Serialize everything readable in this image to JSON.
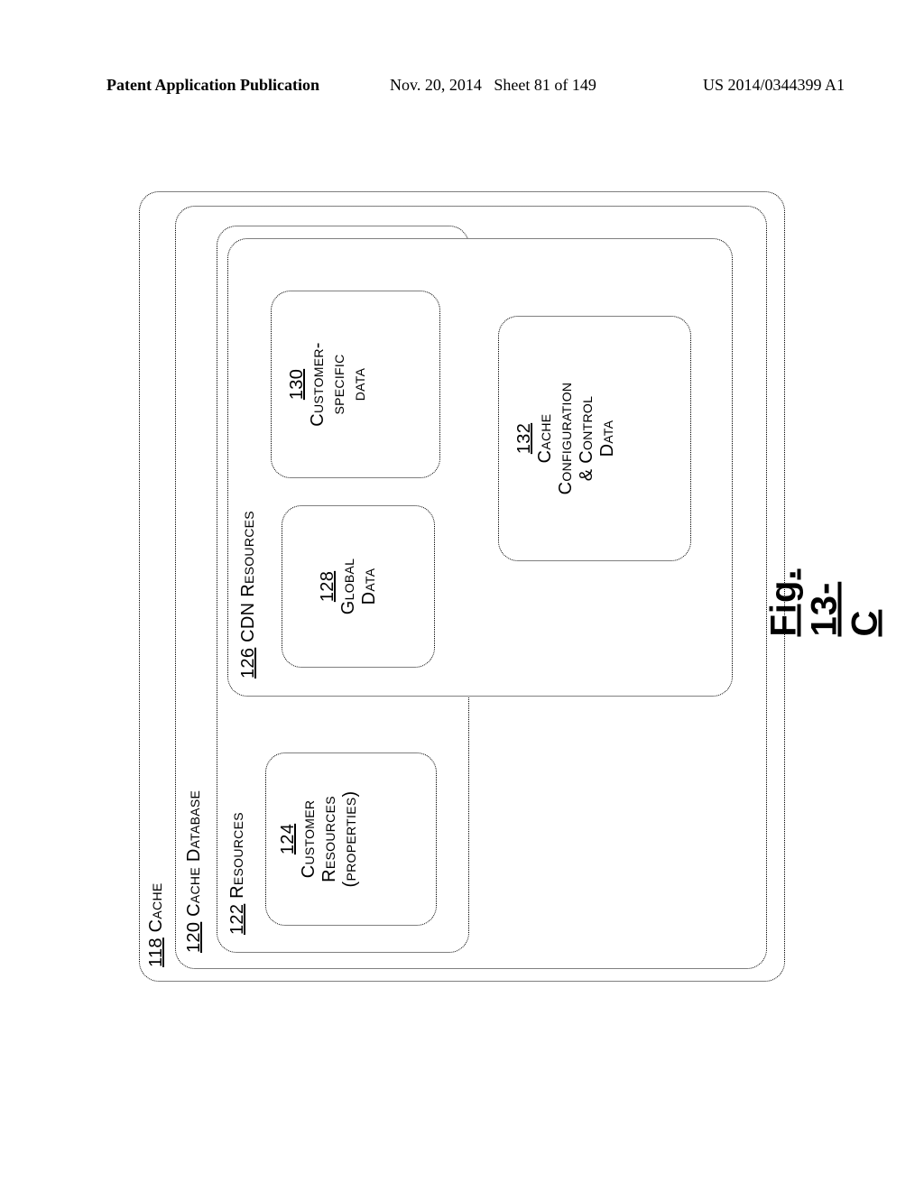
{
  "header": {
    "left": "Patent Application Publication",
    "mid_date": "Nov. 20, 2014",
    "mid_sheet": "Sheet 81 of 149",
    "right": "US 2014/0344399 A1"
  },
  "figure_caption_prefix": "Fig. ",
  "figure_caption_number": "13-C",
  "boxes": {
    "b118": {
      "num": "118",
      "text": "Cache"
    },
    "b120": {
      "num": "120",
      "text": "Cache Database"
    },
    "b122": {
      "num": "122",
      "text": "Resources"
    },
    "b124": {
      "num": "124",
      "l1": "Customer",
      "l2": "Resources",
      "l3": "(properties)"
    },
    "b126": {
      "num": "126",
      "text": "CDN Resources"
    },
    "b128": {
      "num": "128",
      "l1": "Global",
      "l2": "Data"
    },
    "b130": {
      "num": "130",
      "l1": "Customer-",
      "l2": "specific",
      "l3": "data"
    },
    "b132": {
      "num": "132",
      "l1": "Cache",
      "l2": "Configuration",
      "l3": "& Control",
      "l4": "Data"
    }
  }
}
